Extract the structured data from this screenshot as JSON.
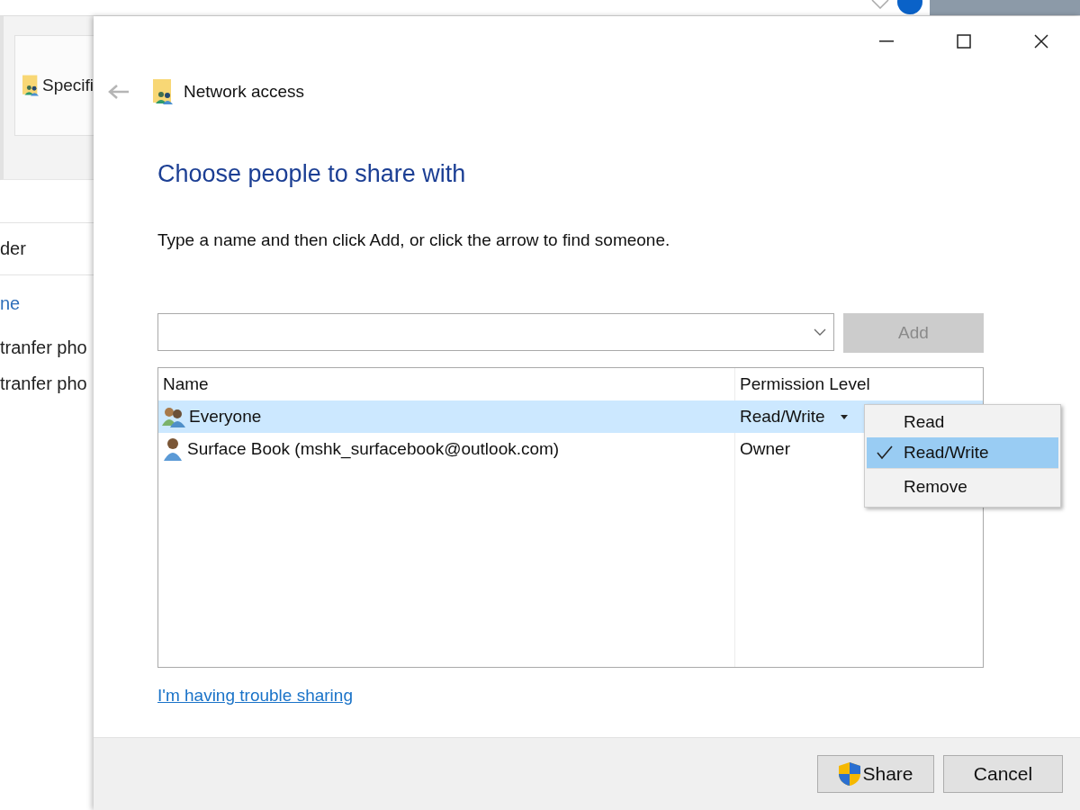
{
  "background_window": {
    "ribbon_item": "Specifi",
    "items": [
      {
        "label": "der",
        "kind": "text"
      },
      {
        "label": "ne",
        "kind": "link"
      },
      {
        "label": "tranfer pho",
        "kind": "text"
      },
      {
        "label": "tranfer pho",
        "kind": "text"
      }
    ]
  },
  "dialog": {
    "title": "Network access",
    "heading": "Choose people to share with",
    "instruction": "Type a name and then click Add, or click the arrow to find someone.",
    "add_button": {
      "label": "Add",
      "disabled": true
    },
    "table": {
      "columns": [
        "Name",
        "Permission Level"
      ],
      "rows": [
        {
          "name": "Everyone",
          "permission": "Read/Write",
          "kind": "group",
          "selected": true
        },
        {
          "name": "Surface Book (mshk_surfacebook@outlook.com)",
          "permission": "Owner",
          "kind": "user",
          "selected": false
        }
      ]
    },
    "permission_menu": {
      "items": [
        {
          "label": "Read",
          "checked": false,
          "selected": false
        },
        {
          "label": "Read/Write",
          "checked": true,
          "selected": true
        },
        {
          "label": "Remove",
          "checked": false,
          "selected": false
        }
      ]
    },
    "help_link": "I'm having trouble sharing",
    "buttons": [
      {
        "label": "Share",
        "kind": "elevated"
      },
      {
        "label": "Cancel",
        "kind": "plain"
      }
    ]
  }
}
